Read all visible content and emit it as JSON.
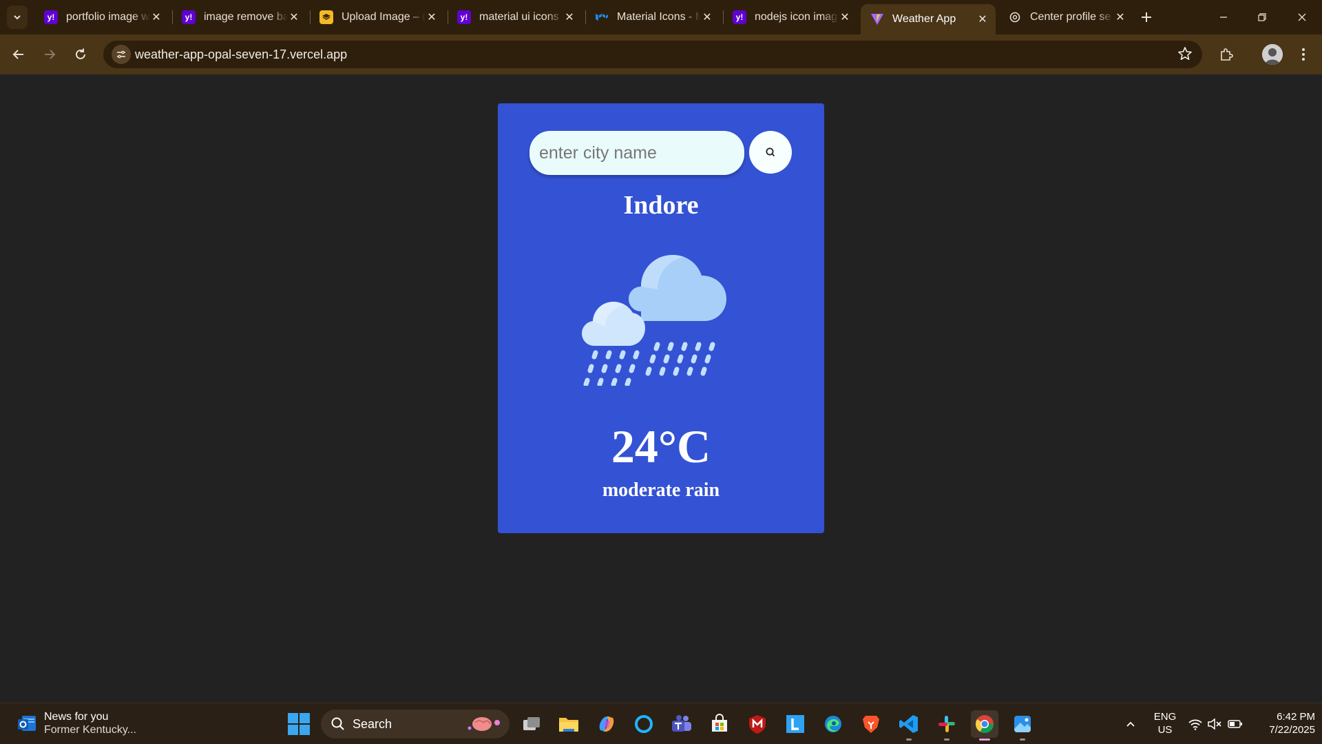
{
  "browser": {
    "tabs": [
      {
        "title": "portfolio image w",
        "favicon": "yahoo-icon",
        "active": false
      },
      {
        "title": "image remove ba",
        "favicon": "yahoo-icon",
        "active": false
      },
      {
        "title": "Upload Image – (",
        "favicon": "upload-icon",
        "active": false
      },
      {
        "title": "material ui icons",
        "favicon": "yahoo-icon",
        "active": false
      },
      {
        "title": "Material Icons - M",
        "favicon": "mui-icon",
        "active": false
      },
      {
        "title": "nodejs icon imag",
        "favicon": "yahoo-icon",
        "active": false
      },
      {
        "title": "Weather App",
        "favicon": "vite-icon",
        "active": true
      },
      {
        "title": "Center profile se",
        "favicon": "openai-icon",
        "active": false
      }
    ],
    "url": "weather-app-opal-seven-17.vercel.app",
    "colors": {
      "frame": "#2e1f0c",
      "toolbar": "#4a3517"
    }
  },
  "weather": {
    "search_placeholder": "enter city name",
    "search_value": "",
    "city": "Indore",
    "temperature": "24°C",
    "description": "moderate rain",
    "icon": "cloud-rain-icon",
    "card_color": "#3452d4"
  },
  "taskbar": {
    "news_title": "News for you",
    "news_subtitle": "Former Kentucky...",
    "search_label": "Search",
    "apps": [
      "task-view-icon",
      "file-explorer-icon",
      "copilot-icon",
      "cortana-icon",
      "teams-icon",
      "microsoft-store-icon",
      "mcafee-icon",
      "l-app-icon",
      "edge-icon",
      "brave-icon",
      "vscode-icon",
      "slack-icon",
      "chrome-icon",
      "photos-icon"
    ],
    "lang_line1": "ENG",
    "lang_line2": "US",
    "time": "6:42 PM",
    "date": "7/22/2025"
  }
}
